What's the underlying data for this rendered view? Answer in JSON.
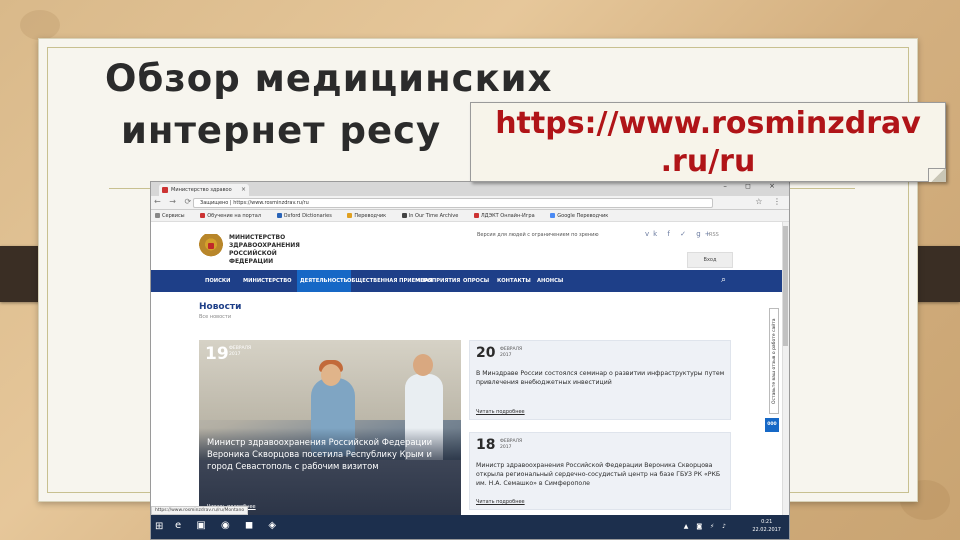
{
  "slide": {
    "title_line1": "Обзор медицинских",
    "title_line2": "интернет ресу",
    "callout_line1": "https://www.rosminzdrav",
    "callout_line2": ".ru/ru"
  },
  "browser": {
    "tab_title": "Министерство здравоо",
    "tab_close": "×",
    "window_controls": "– ◻ ×",
    "nav_icons": "← → ⟳",
    "address": "Защищено | https://www.rosminzdrav.ru/ru",
    "menu_icons": "☆ ⋮",
    "bookmarks": [
      "Сервисы",
      "Обучение на портал",
      "Oxford Dictionaries",
      "Переводчик",
      "In Our Time Archive",
      "ЛДЭКТ Онлайн-Игра",
      "Google Переводчик"
    ],
    "status_url": "https://www.rosminzdrav.ru/ru/Montano"
  },
  "site": {
    "ministry_name": "МИНИСТЕРСТВО ЗДРАВООХРАНЕНИЯ РОССИЙСКОЙ ФЕДЕРАЦИИ",
    "vision_link": "Версия для людей с ограничением по зрению",
    "socials": "vk f ✓ g+",
    "rss": "RSS",
    "login": "Вход",
    "nav": [
      "ПОИСКИ",
      "МИНИСТЕРСТВО",
      "ДЕЯТЕЛЬНОСТЬ",
      "ОБЩЕСТВЕННАЯ ПРИЕМНАЯ",
      "МЕРОПРИЯТИЯ",
      "ОПРОСЫ",
      "КОНТАКТЫ",
      "АНОНСЫ"
    ],
    "news_title": "Новости",
    "news_sub": "Все новости",
    "featured": {
      "day": "19",
      "month_year": "ФЕВРАЛЯ\n2017",
      "caption": "Министр здравоохранения Российской Федерации Вероника Скворцова посетила Республику Крым и город Севастополь с рабочим визитом",
      "read": "Читать подробнее"
    },
    "cards": [
      {
        "day": "20",
        "month_year": "ФЕВРАЛЯ\n2017",
        "text": "В Минздраве России состоялся семинар о развитии инфраструктуры путем привлечения внебюджетных инвестиций",
        "read": "Читать подробнее"
      },
      {
        "day": "18",
        "month_year": "ФЕВРАЛЯ\n2017",
        "text": "Министр здравоохранения Российской Федерации Вероника Скворцова открыла региональный сердечно-сосудистый центр на базе ГБУЗ РК «РКБ им. Н.А. Семашко» в Симферополе",
        "read": "Читать подробнее"
      }
    ],
    "feedback": "Оставьте ваш отзыв о работе сайта",
    "badge": "000"
  },
  "taskbar": {
    "start": "⊞",
    "apps": "e ▣ ◉ ◼ ◈",
    "tray": "▲ ◙ ⚡ ♪",
    "time": "0:21",
    "date": "22.02.2017"
  },
  "colors": {
    "nav_blue": "#1e3f88",
    "active_blue": "#1668c6",
    "callout_red": "#b01418"
  }
}
